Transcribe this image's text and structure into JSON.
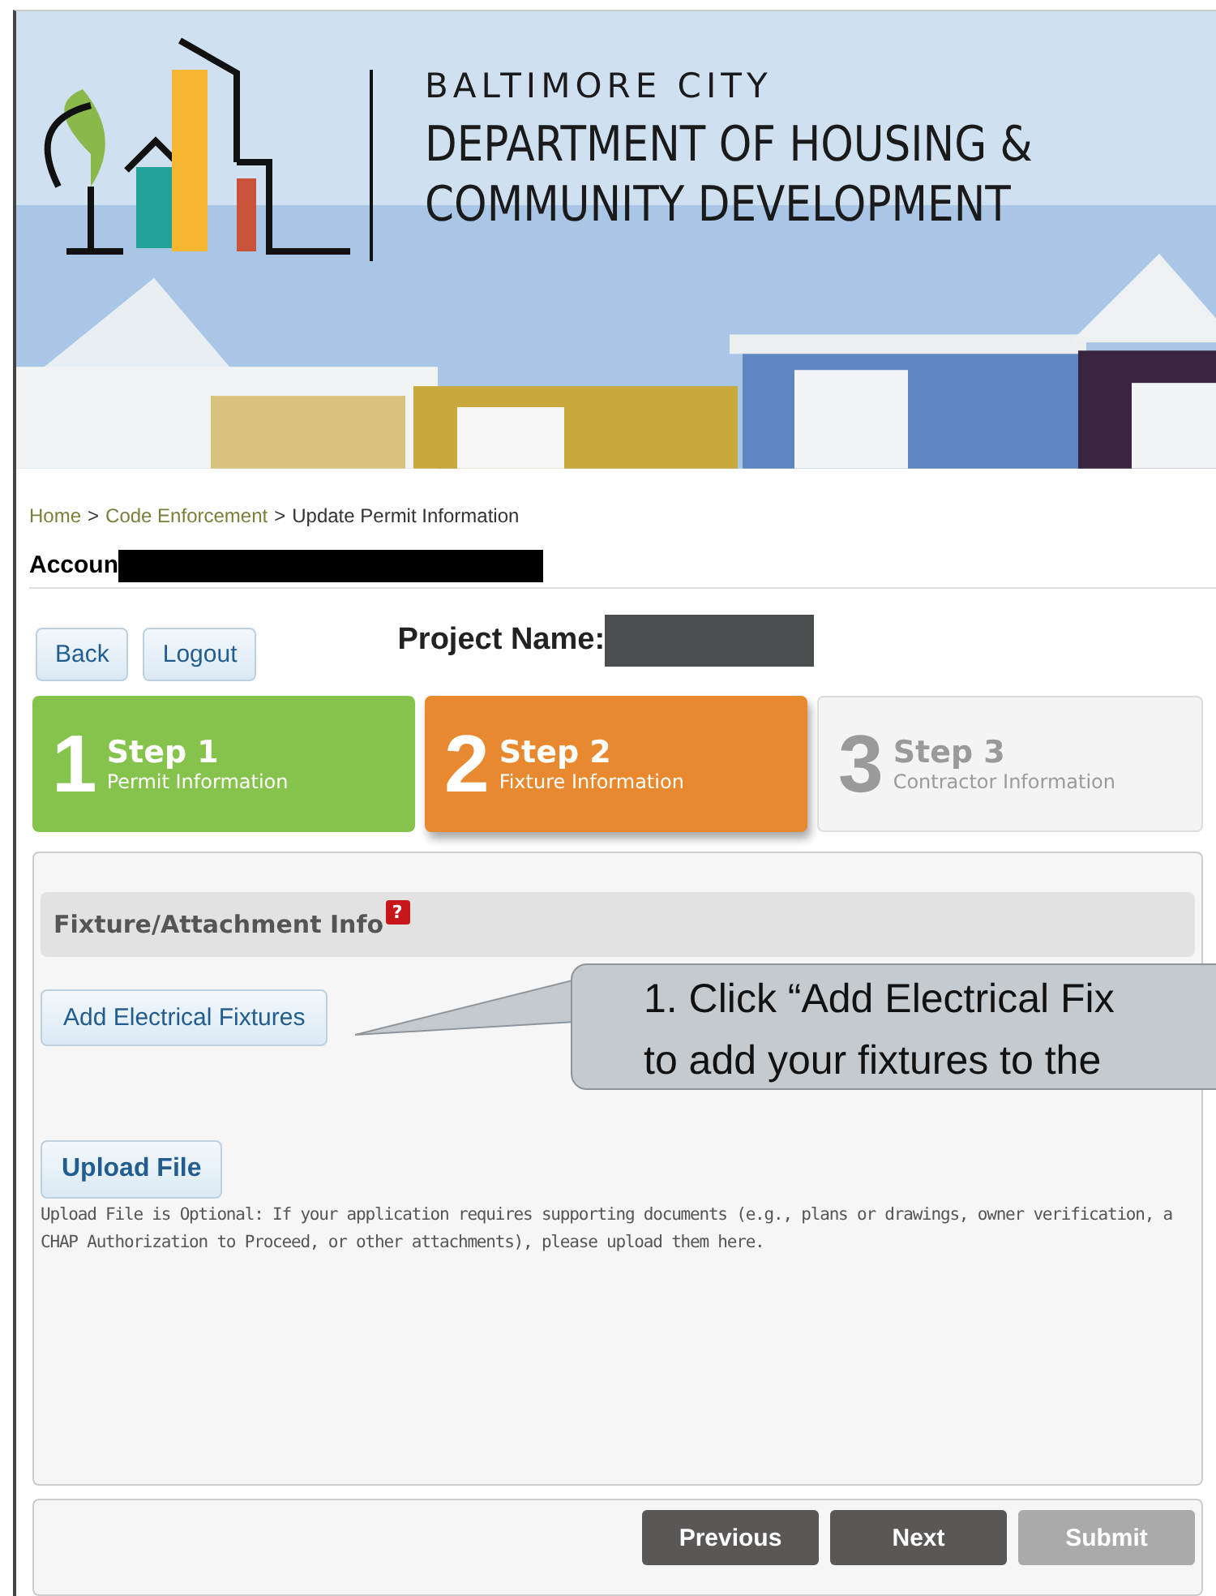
{
  "header": {
    "kind": "picture",
    "org_line": "BALTIMORE CITY",
    "dept_lines": [
      "DEPARTMENT OF HOUSING &",
      "COMMUNITY DEVELOPMENT"
    ]
  },
  "breadcrumb": [
    {
      "label": "Home",
      "link": true
    },
    {
      "label": "Code Enforcement",
      "link": true
    },
    {
      "label": "Update Permit Information",
      "link": false
    }
  ],
  "separator": ">",
  "account_label": "Accoun",
  "nav_buttons": [
    "Back",
    "Logout"
  ],
  "project_label": "Project Name:",
  "steps": [
    {
      "number": "1",
      "title": "Step 1",
      "subtitle": "Permit Information",
      "kind": "done"
    },
    {
      "number": "2",
      "title": "Step 2",
      "subtitle": "Fixture Information",
      "kind": "current"
    },
    {
      "number": "3",
      "title": "Step 3",
      "subtitle": "Contractor Information",
      "kind": "upcoming"
    }
  ],
  "section": {
    "title": "Fixture/Attachment Info",
    "help_icon": "?"
  },
  "add_button": "Add Electrical Fixtures",
  "callout": {
    "lines": [
      "1. Click “Add Electrical Fix",
      "to add your fixtures to the"
    ]
  },
  "upload_button": "Upload File",
  "upload_note": "Upload File is Optional: If your application requires supporting documents (e.g., plans or drawings, owner verification, a CHAP Authorization to Proceed, or other attachments), please upload them here.",
  "footer_buttons": [
    {
      "label": "Previous",
      "disabled": false
    },
    {
      "label": "Next",
      "disabled": false
    },
    {
      "label": "Submit",
      "disabled": true
    }
  ]
}
